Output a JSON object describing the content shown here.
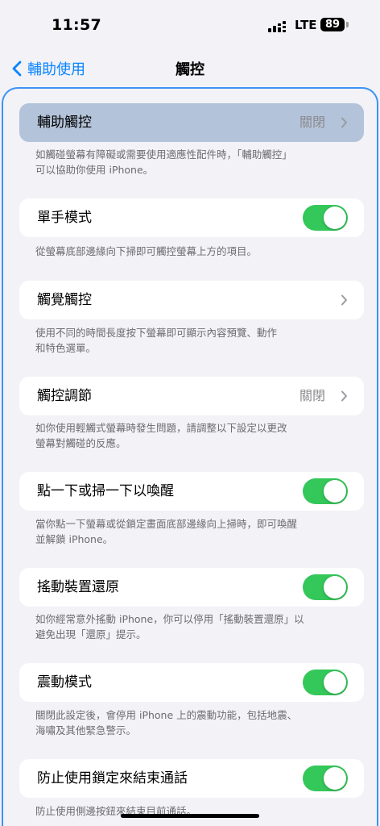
{
  "status_bar": {
    "time": "11:57",
    "network": "LTE",
    "battery": "89"
  },
  "nav": {
    "back_label": "輔助使用",
    "title": "觸控"
  },
  "rows": [
    {
      "label": "輔助觸控",
      "value": "關閉",
      "footer": [
        "如觸碰螢幕有障礙或需要使用適應性配件時，「輔助觸控」",
        "可以協助你使用 iPhone。"
      ]
    },
    {
      "label": "單手模式",
      "footer": [
        "從螢幕底部邊緣向下掃即可觸控螢幕上方的項目。"
      ]
    },
    {
      "label": "觸覺觸控",
      "footer": [
        "使用不同的時間長度按下螢幕即可顯示內容預覽、動作",
        "和特色選單。"
      ]
    },
    {
      "label": "觸控調節",
      "value": "關閉",
      "footer": [
        "如你使用輕觸式螢幕時發生問題，請調整以下設定以更改",
        "螢幕對觸碰的反應。"
      ]
    },
    {
      "label": "點一下或掃一下以喚醒",
      "footer": [
        "當你點一下螢幕或從鎖定畫面底部邊緣向上掃時，即可喚醒",
        "並解鎖 iPhone。"
      ]
    },
    {
      "label": "搖動裝置還原",
      "footer": [
        "如你經常意外搖動 iPhone，你可以停用「搖動裝置還原」以",
        "避免出現「還原」提示。"
      ]
    },
    {
      "label": "震動模式",
      "footer": [
        "關閉此設定後，會停用 iPhone 上的震動功能，包括地震、",
        "海嘯及其他緊急警示。"
      ]
    },
    {
      "label": "防止使用鎖定來結束通話",
      "footer": [
        "防止使用側邊按鈕來結束目前通話。"
      ]
    }
  ],
  "toggles": {
    "one_handed": true,
    "tap_to_wake": true,
    "shake_undo": true,
    "vibration": true,
    "lock_end_call": true
  },
  "colors": {
    "accent": "#0a84ff",
    "toggle_on": "#34c759",
    "selected_row": "#b3c3d9",
    "focus_border": "#3d93f5"
  }
}
